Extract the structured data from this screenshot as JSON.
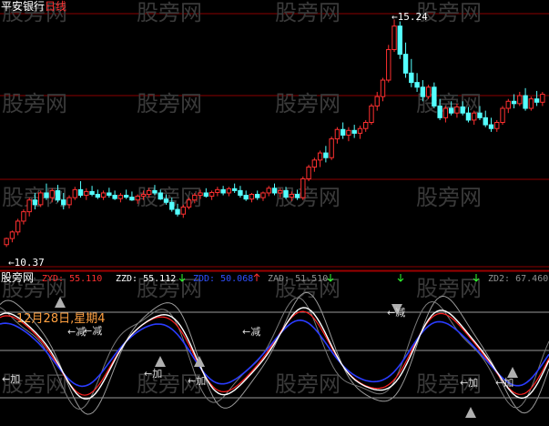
{
  "watermark": "股旁网",
  "top_panel": {
    "stock_name": "平安银行",
    "period": "日线",
    "high_marker": "15.24",
    "low_marker": "10.37"
  },
  "indicator_panel": {
    "brand": "股旁网",
    "readouts": [
      {
        "label": "ZYD:",
        "value": "55.110",
        "color": "#ff3030"
      },
      {
        "label": "ZZD:",
        "value": "55.112",
        "color": "#ffffff"
      },
      {
        "label": "ZDD:",
        "value": "50.068",
        "color": "#3050ff"
      },
      {
        "label": "ZAD:",
        "value": "51.510",
        "color": "#909090"
      },
      {
        "label": "ZD2:",
        "value": "67.460",
        "color": "#909090"
      }
    ],
    "date_note": "12月28日,星期4",
    "signal_add": "加",
    "signal_reduce": "减"
  },
  "colors": {
    "up_candle": "#ff3030",
    "down_candle": "#54ffff",
    "grid": "#8b0000",
    "white_line": "#ffffff",
    "red_line": "#ff2020",
    "blue_line": "#2a3cff",
    "gray_line": "#9a9a9a",
    "arrow_green": "#30ff30",
    "arrow_red": "#ff3030",
    "note_color": "#ffa040"
  },
  "chart_data": {
    "type": "candlestick",
    "price_axis_ylim": [
      10.0,
      15.5
    ],
    "candles": [
      [
        10.45,
        10.6,
        10.4,
        10.58
      ],
      [
        10.58,
        10.75,
        10.5,
        10.72
      ],
      [
        10.72,
        11.0,
        10.65,
        10.95
      ],
      [
        10.95,
        11.2,
        10.88,
        11.15
      ],
      [
        11.15,
        11.45,
        11.05,
        11.4
      ],
      [
        11.4,
        11.55,
        11.2,
        11.3
      ],
      [
        11.3,
        11.6,
        11.25,
        11.55
      ],
      [
        11.55,
        11.75,
        11.4,
        11.45
      ],
      [
        11.45,
        11.65,
        11.35,
        11.6
      ],
      [
        11.6,
        11.72,
        11.35,
        11.4
      ],
      [
        11.4,
        11.55,
        11.2,
        11.3
      ],
      [
        11.3,
        11.5,
        11.22,
        11.45
      ],
      [
        11.45,
        11.68,
        11.4,
        11.62
      ],
      [
        11.62,
        11.8,
        11.45,
        11.5
      ],
      [
        11.5,
        11.65,
        11.4,
        11.58
      ],
      [
        11.58,
        11.7,
        11.48,
        11.52
      ],
      [
        11.52,
        11.62,
        11.42,
        11.46
      ],
      [
        11.46,
        11.6,
        11.4,
        11.55
      ],
      [
        11.55,
        11.66,
        11.45,
        11.5
      ],
      [
        11.5,
        11.6,
        11.4,
        11.43
      ],
      [
        11.43,
        11.55,
        11.35,
        11.5
      ],
      [
        11.5,
        11.62,
        11.42,
        11.46
      ],
      [
        11.46,
        11.58,
        11.38,
        11.4
      ],
      [
        11.4,
        11.52,
        11.32,
        11.48
      ],
      [
        11.48,
        11.6,
        11.4,
        11.52
      ],
      [
        11.52,
        11.66,
        11.45,
        11.6
      ],
      [
        11.6,
        11.72,
        11.5,
        11.55
      ],
      [
        11.55,
        11.62,
        11.4,
        11.42
      ],
      [
        11.42,
        11.52,
        11.3,
        11.35
      ],
      [
        11.35,
        11.45,
        11.15,
        11.2
      ],
      [
        11.2,
        11.32,
        11.05,
        11.1
      ],
      [
        11.1,
        11.3,
        11.02,
        11.25
      ],
      [
        11.25,
        11.45,
        11.2,
        11.4
      ],
      [
        11.4,
        11.55,
        11.33,
        11.5
      ],
      [
        11.5,
        11.62,
        11.42,
        11.55
      ],
      [
        11.55,
        11.65,
        11.45,
        11.48
      ],
      [
        11.48,
        11.6,
        11.4,
        11.56
      ],
      [
        11.56,
        11.68,
        11.48,
        11.62
      ],
      [
        11.62,
        11.7,
        11.5,
        11.55
      ],
      [
        11.55,
        11.68,
        11.48,
        11.64
      ],
      [
        11.64,
        11.75,
        11.55,
        11.6
      ],
      [
        11.6,
        11.7,
        11.45,
        11.5
      ],
      [
        11.5,
        11.6,
        11.38,
        11.42
      ],
      [
        11.42,
        11.55,
        11.35,
        11.52
      ],
      [
        11.52,
        11.6,
        11.4,
        11.45
      ],
      [
        11.45,
        11.58,
        11.38,
        11.55
      ],
      [
        11.55,
        11.7,
        11.48,
        11.65
      ],
      [
        11.65,
        11.75,
        11.5,
        11.55
      ],
      [
        11.55,
        11.65,
        11.45,
        11.6
      ],
      [
        11.6,
        11.68,
        11.42,
        11.46
      ],
      [
        11.46,
        11.58,
        11.38,
        11.52
      ],
      [
        11.52,
        11.62,
        11.4,
        11.45
      ],
      [
        11.45,
        11.9,
        11.4,
        11.85
      ],
      [
        11.85,
        12.15,
        11.8,
        12.1
      ],
      [
        12.1,
        12.3,
        12.0,
        12.25
      ],
      [
        12.25,
        12.45,
        12.1,
        12.4
      ],
      [
        12.4,
        12.55,
        12.2,
        12.3
      ],
      [
        12.3,
        12.75,
        12.25,
        12.7
      ],
      [
        12.7,
        12.95,
        12.6,
        12.9
      ],
      [
        12.9,
        13.05,
        12.7,
        12.78
      ],
      [
        12.78,
        12.95,
        12.65,
        12.88
      ],
      [
        12.88,
        13.0,
        12.72,
        12.82
      ],
      [
        12.82,
        12.98,
        12.7,
        12.92
      ],
      [
        12.92,
        13.1,
        12.85,
        13.05
      ],
      [
        13.05,
        13.45,
        13.0,
        13.4
      ],
      [
        13.4,
        13.7,
        13.3,
        13.6
      ],
      [
        13.6,
        14.0,
        13.5,
        13.95
      ],
      [
        13.95,
        14.7,
        13.9,
        14.6
      ],
      [
        14.6,
        15.24,
        14.55,
        15.1
      ],
      [
        15.1,
        15.2,
        14.4,
        14.5
      ],
      [
        14.5,
        14.75,
        14.0,
        14.1
      ],
      [
        14.1,
        14.4,
        13.8,
        13.9
      ],
      [
        13.9,
        14.1,
        13.7,
        13.8
      ],
      [
        13.8,
        13.95,
        13.5,
        13.6
      ],
      [
        13.6,
        13.85,
        13.55,
        13.8
      ],
      [
        13.8,
        13.9,
        13.35,
        13.4
      ],
      [
        13.4,
        13.55,
        13.1,
        13.15
      ],
      [
        13.15,
        13.4,
        13.05,
        13.35
      ],
      [
        13.35,
        13.5,
        13.2,
        13.25
      ],
      [
        13.25,
        13.45,
        13.15,
        13.38
      ],
      [
        13.38,
        13.5,
        13.2,
        13.25
      ],
      [
        13.25,
        13.38,
        13.05,
        13.1
      ],
      [
        13.1,
        13.3,
        13.0,
        13.25
      ],
      [
        13.25,
        13.4,
        13.1,
        13.15
      ],
      [
        13.15,
        13.3,
        12.95,
        13.0
      ],
      [
        13.0,
        13.15,
        12.85,
        12.92
      ],
      [
        12.92,
        13.1,
        12.85,
        13.05
      ],
      [
        13.05,
        13.4,
        13.0,
        13.35
      ],
      [
        13.35,
        13.55,
        13.25,
        13.5
      ],
      [
        13.5,
        13.65,
        13.35,
        13.45
      ],
      [
        13.45,
        13.7,
        13.4,
        13.62
      ],
      [
        13.62,
        13.78,
        13.3,
        13.35
      ],
      [
        13.35,
        13.6,
        13.3,
        13.55
      ],
      [
        13.55,
        13.72,
        13.4,
        13.48
      ],
      [
        13.48,
        13.7,
        13.4,
        13.65
      ]
    ],
    "indicator_series": [
      "ZYD",
      "ZZD",
      "ZDD",
      "ZAD",
      "ZD2"
    ],
    "indicator_ylim": [
      0,
      100
    ]
  }
}
